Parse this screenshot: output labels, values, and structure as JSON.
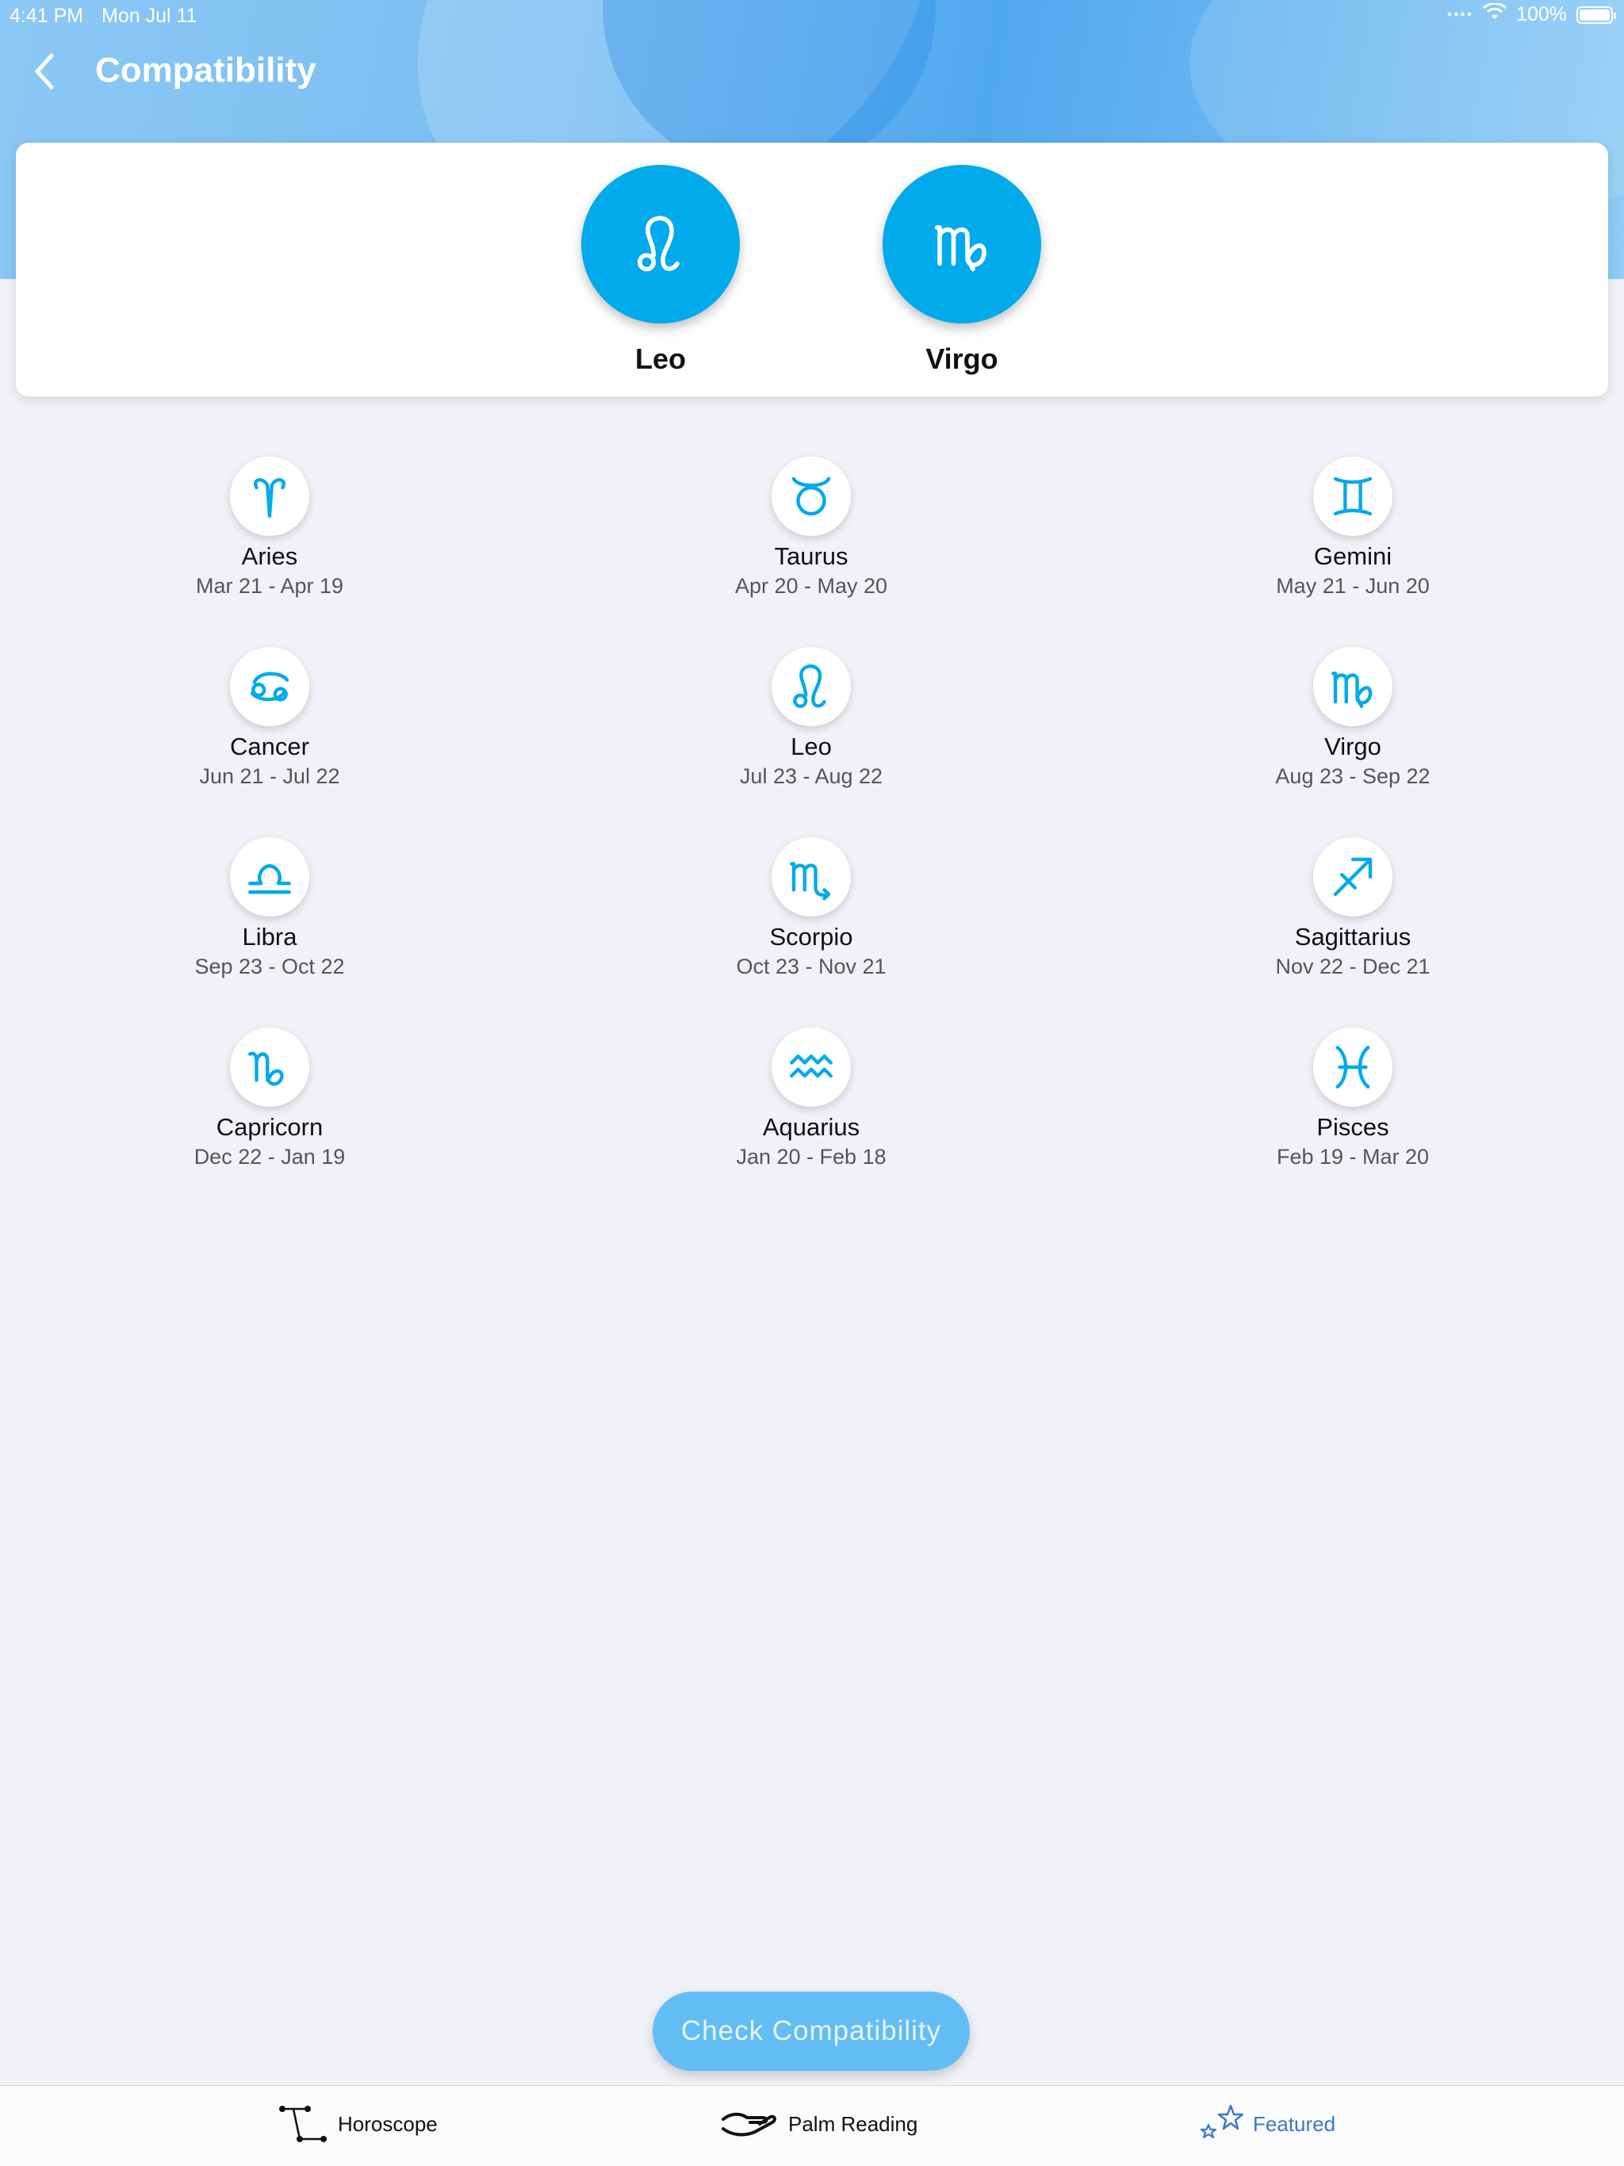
{
  "status_bar": {
    "time": "4:41 PM",
    "date": "Mon Jul 11",
    "battery": "100%",
    "battery_level": 1.0
  },
  "header": {
    "title": "Compatibility"
  },
  "selection": [
    {
      "name": "Leo",
      "icon": "leo-icon"
    },
    {
      "name": "Virgo",
      "icon": "virgo-icon"
    }
  ],
  "signs": [
    {
      "name": "Aries",
      "dates": "Mar 21 - Apr 19",
      "icon": "aries-icon"
    },
    {
      "name": "Taurus",
      "dates": "Apr 20 - May 20",
      "icon": "taurus-icon"
    },
    {
      "name": "Gemini",
      "dates": "May 21 - Jun 20",
      "icon": "gemini-icon"
    },
    {
      "name": "Cancer",
      "dates": "Jun 21 - Jul 22",
      "icon": "cancer-icon"
    },
    {
      "name": "Leo",
      "dates": "Jul 23 - Aug 22",
      "icon": "leo-icon"
    },
    {
      "name": "Virgo",
      "dates": "Aug 23 - Sep 22",
      "icon": "virgo-icon"
    },
    {
      "name": "Libra",
      "dates": "Sep 23 - Oct 22",
      "icon": "libra-icon"
    },
    {
      "name": "Scorpio",
      "dates": "Oct 23 - Nov 21",
      "icon": "scorpio-icon"
    },
    {
      "name": "Sagittarius",
      "dates": "Nov 22 - Dec 21",
      "icon": "sagittarius-icon"
    },
    {
      "name": "Capricorn",
      "dates": "Dec 22 - Jan 19",
      "icon": "capricorn-icon"
    },
    {
      "name": "Aquarius",
      "dates": "Jan 20 - Feb 18",
      "icon": "aquarius-icon"
    },
    {
      "name": "Pisces",
      "dates": "Feb 19 - Mar 20",
      "icon": "pisces-icon"
    }
  ],
  "actions": {
    "check_label": "Check  Compatibility"
  },
  "tabs": [
    {
      "label": "Horoscope",
      "icon": "constellation-icon",
      "active": false
    },
    {
      "label": "Palm Reading",
      "icon": "palm-icon",
      "active": false
    },
    {
      "label": "Featured",
      "icon": "stars-icon",
      "active": true
    }
  ],
  "colors": {
    "accent": "#00aaeb",
    "button": "#63bdf5",
    "active_tab": "#3c78c8",
    "background": "#f0f2f7"
  }
}
